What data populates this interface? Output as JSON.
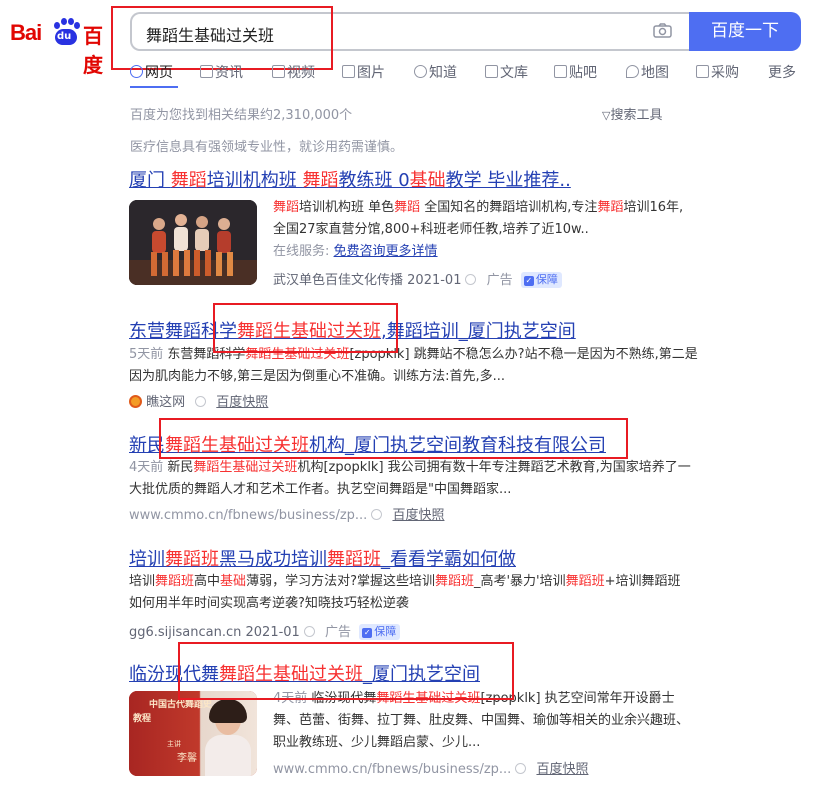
{
  "logo": {
    "bai": "Bai",
    "du_badge": "du",
    "cn": "百度"
  },
  "search": {
    "query": "舞蹈生基础过关班",
    "button_label": "百度一下"
  },
  "tabs": [
    {
      "label": "网页",
      "icon": "search-icon",
      "active": true
    },
    {
      "label": "资讯",
      "icon": "news-icon"
    },
    {
      "label": "视频",
      "icon": "video-icon"
    },
    {
      "label": "图片",
      "icon": "image-icon"
    },
    {
      "label": "知道",
      "icon": "question-icon"
    },
    {
      "label": "文库",
      "icon": "document-icon"
    },
    {
      "label": "贴吧",
      "icon": "tieba-icon"
    },
    {
      "label": "地图",
      "icon": "map-icon"
    },
    {
      "label": "采购",
      "icon": "purchase-icon"
    },
    {
      "label": "更多",
      "icon": ""
    }
  ],
  "result_count": "百度为您找到相关结果约2,310,000个",
  "search_tools": "搜索工具",
  "medical_notice": "医疗信息具有强领域专业性，就诊用药需谨慎。",
  "results": [
    {
      "title_parts": [
        "厦门 ",
        "舞蹈",
        "培训机构班 ",
        "舞蹈",
        "教练班 0",
        "基础",
        "教学 毕业推荐.."
      ],
      "snippet_line1_parts": [
        "舞蹈",
        "培训机构班 单色",
        "舞蹈",
        " 全国知名的舞蹈培训机构,专注",
        "舞蹈",
        "培训16年,"
      ],
      "snippet_line2": "全国27家直营分馆,800+科班老师任教,培养了近10w..",
      "service_label": "在线服务:",
      "service_link": "免费咨询更多详情",
      "source": "武汉单色百佳文化传播",
      "date": "2021-01",
      "ad_label": "广告",
      "guarantee_label": "保障",
      "thumbnail_icon": "dancers-photo"
    },
    {
      "title_parts": [
        "东营舞蹈科学",
        "舞蹈生基础过关班",
        ",舞蹈培训_厦门执艺空间"
      ],
      "day": "5天前",
      "snippet_line1_parts": [
        " 东营舞蹈科学",
        "舞蹈生基础过关班",
        "[zpopklk] 跳舞站不稳怎么办?站不稳一是因为不熟练,第二是"
      ],
      "snippet_line2": "因为肌肉能力不够,第三是因为倒重心不准确。训练方法:首先,多...",
      "source": "瞧这网",
      "snapshot": "百度快照"
    },
    {
      "title_parts": [
        "新民",
        "舞蹈生基础过关班",
        "机构_厦门执艺空间教育科技有限公司"
      ],
      "day": "4天前",
      "snippet_line1_parts": [
        " 新民",
        "舞蹈生基础过关班",
        "机构[zpopklk] 我公司拥有数十年专注舞蹈艺术教育,为国家培养了一"
      ],
      "snippet_line2": "大批优质的舞蹈人才和艺术工作者。执艺空间舞蹈是\"中国舞蹈家...",
      "source": "www.cmmo.cn/fbnews/business/zp...",
      "snapshot": "百度快照"
    },
    {
      "title_parts": [
        "培训",
        "舞蹈班",
        "黑马成功培训",
        "舞蹈班",
        "_看看学霸如何做"
      ],
      "snippet_line1_parts": [
        "培训",
        "舞蹈班",
        "高中",
        "基础",
        "薄弱，学习方法对?掌握这些培训",
        "舞蹈班",
        "_高考'暴力'培训",
        "舞蹈班",
        "+培训舞蹈班"
      ],
      "snippet_line2": "如何用半年时间实现高考逆袭?知晓技巧轻松逆袭",
      "source": "gg6.sijisancan.cn",
      "date": "2021-01",
      "ad_label": "广告",
      "guarantee_label": "保障"
    },
    {
      "title_parts": [
        "临汾现代舞",
        "舞蹈生基础过关班",
        "_厦门执艺空间"
      ],
      "day": "4天前",
      "snippet_line1_parts": [
        " 临汾现代舞",
        "舞蹈生基础过关班",
        "[zpopklk] 执艺空间常年开设爵士"
      ],
      "snippet_line2": "舞、芭蕾、街舞、拉丁舞、肚皮舞、中国舞、瑜伽等相关的业余兴趣班、",
      "snippet_line3": "职业教练班、少儿舞蹈启蒙、少儿...",
      "source": "www.cmmo.cn/fbnews/business/zp...",
      "snapshot": "百度快照",
      "thumbnail_text": [
        "中国古代舞蹈史",
        "教程",
        "主讲",
        "李馨"
      ]
    }
  ]
}
